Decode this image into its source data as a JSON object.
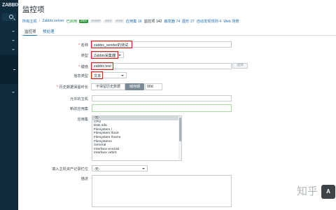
{
  "sidebar": {
    "logo": "ZABBIX",
    "icons": [
      "collapse-icon",
      "search-icon",
      "monitoring-icon",
      "inventory-icon",
      "reports-icon",
      "configuration-icon",
      "administration-icon"
    ]
  },
  "header": {
    "title": "监控项"
  },
  "breadcrumb": {
    "all_hosts": "所有主机",
    "host": "Zabbix server",
    "enabled": "已启用",
    "zbx": "ZBX",
    "snmp": "SNMP",
    "jmx": "JMX",
    "ipmi": "IPMI",
    "applications": "应用集 16",
    "items": "监控项 142",
    "triggers": "触发器 74",
    "graphs": "图形 27",
    "discovery": "自动发现规则 4",
    "web": "Web 场景"
  },
  "tabs": {
    "item": "监控项",
    "preprocessing": "预处理"
  },
  "form": {
    "name_label": "名称",
    "name_value": "zabbix_sender的测试",
    "type_label": "类型",
    "type_value": "Zabbix采集器",
    "key_label": "键值",
    "key_value": "zabbix.test",
    "select_button": "选择",
    "info_type_label": "信息类型",
    "info_type_value": "文本",
    "history_label": "历史数据保留时长",
    "history_option_1": "不保留历史数据",
    "history_option_2": "储存期",
    "history_value": "90d",
    "allowed_hosts_label": "允许的主机",
    "new_app_label": "新的应用集",
    "applications_label": "应用集",
    "applications_options": [
      "-无-",
      "CPU",
      "Disk sda",
      "Filesystem /",
      "Filesystem /boot",
      "Filesystem /home",
      "Filesystems",
      "General",
      "Interface ens192",
      "Interface virbr0"
    ],
    "selected_application_index": 0,
    "inventory_label": "填入主机资产记录栏位",
    "inventory_value": "-无-",
    "description_label": "描述"
  },
  "watermark": {
    "text": "知乎",
    "badge": "A"
  },
  "colors": {
    "sidebar": "#0f2b3c",
    "link": "#1f6fb3",
    "highlight_box": "#d8261c",
    "enabled_green": "#13962c"
  }
}
